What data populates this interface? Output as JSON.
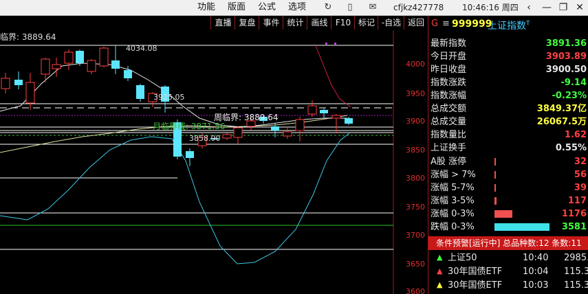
{
  "menu": [
    "功能",
    "版面",
    "公式",
    "选项"
  ],
  "user": "cfjkz427778",
  "clock": "10:46:16 周四",
  "toolbar": [
    "直播",
    "复盘",
    "事件",
    "统计",
    "画线",
    "F10",
    "标记",
    "-自选",
    "返回"
  ],
  "chart": {
    "crit_top": "临界: 3889.64",
    "labels": {
      "high": "4034.08",
      "mid": "3925.05",
      "crit": "周临界: 3889.64",
      "monthly": "月临界线: 3871.56",
      "low": "3858.90"
    },
    "price_axis": [
      "4000",
      "3950",
      "3900",
      "3850",
      "3800",
      "3750",
      "3700",
      "3650",
      "3600"
    ]
  },
  "panel": {
    "g": "G",
    "lines": "≡",
    "code": "999999",
    "name": "上证指数",
    "sup": "T",
    "stats": [
      {
        "label": "最新指数",
        "value": "3891.36",
        "color": "#40ff40"
      },
      {
        "label": "今日开盘",
        "value": "3903.89",
        "color": "#ff4040"
      },
      {
        "label": "昨日收盘",
        "value": "3900.50",
        "color": "#e8e8e8"
      },
      {
        "label": "指数涨跌",
        "value": "-9.14",
        "color": "#40ff40"
      },
      {
        "label": "指数涨幅",
        "value": "-0.23%",
        "color": "#40ff40"
      },
      {
        "label": "总成交额",
        "value": "3849.37亿",
        "color": "#ffff40"
      },
      {
        "label": "总成交量",
        "value": "26067.5万",
        "color": "#ffff40"
      },
      {
        "label": "指数量比",
        "value": "1.62",
        "color": "#ff4040"
      },
      {
        "label": "上证换手",
        "value": "0.55%",
        "color": "#e8e8e8"
      }
    ],
    "breadth": [
      {
        "label": "A股 涨停",
        "value": "32",
        "color": "#ff4040"
      },
      {
        "label": "涨幅 > 7%",
        "value": "56",
        "color": "#ff4040"
      },
      {
        "label": "涨幅 5-7%",
        "value": "39",
        "color": "#ff4040"
      },
      {
        "label": "涨幅 3-5%",
        "value": "117",
        "color": "#ff4040"
      },
      {
        "label": "涨幅 0-3%",
        "value": "1176",
        "color": "#ff4040"
      },
      {
        "label": "跌幅 0-3%",
        "value": "3581",
        "color": "#40ff40"
      }
    ],
    "alert": "条件预警[运行中] 总品种数:12 条数:11",
    "alerts": [
      {
        "icon": "▲",
        "iconColor": "#40ff40",
        "name": "上证50",
        "time": "10:40",
        "value": "2985."
      },
      {
        "icon": "▲",
        "iconColor": "#ff4040",
        "name": "30年国债ETF",
        "time": "10:04",
        "value": "115.3"
      },
      {
        "icon": "▲",
        "iconColor": "#ffff40",
        "name": "30年国债ETF",
        "time": "10:03",
        "value": "115.3"
      }
    ]
  }
}
